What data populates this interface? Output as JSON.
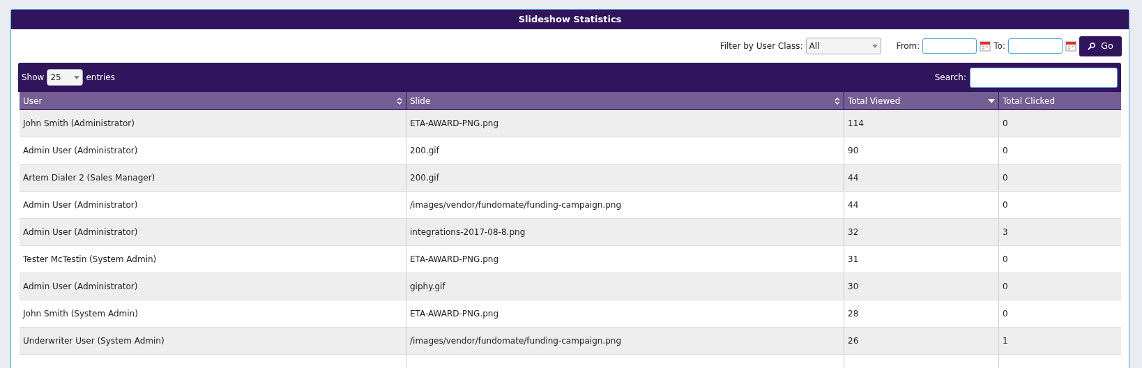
{
  "title": "Slideshow Statistics",
  "filter": {
    "label": "Filter by User Class:",
    "value": "All",
    "from_label": "From:",
    "to_label": "To:",
    "go": "Go"
  },
  "table_toolbar": {
    "show": "Show",
    "length": "25",
    "entries": "entries",
    "search_label": "Search:"
  },
  "columns": [
    {
      "label": "User",
      "sortable": true,
      "sorted": false
    },
    {
      "label": "Slide",
      "sortable": true,
      "sorted": false
    },
    {
      "label": "Total Viewed",
      "sortable": true,
      "sorted": true
    },
    {
      "label": "Total Clicked",
      "sortable": false,
      "sorted": false
    }
  ],
  "rows": [
    [
      "John Smith (Administrator)",
      "ETA-AWARD-PNG.png",
      "114",
      "0"
    ],
    [
      "Admin User (Administrator)",
      "200.gif",
      "90",
      "0"
    ],
    [
      "Artem Dialer 2 (Sales Manager)",
      "200.gif",
      "44",
      "0"
    ],
    [
      "Admin User (Administrator)",
      "/images/vendor/fundomate/funding-campaign.png",
      "44",
      "0"
    ],
    [
      "Admin User (Administrator)",
      "integrations-2017-08-8.png",
      "32",
      "3"
    ],
    [
      "Tester McTestin (System Admin)",
      "ETA-AWARD-PNG.png",
      "31",
      "0"
    ],
    [
      "Admin User (Administrator)",
      "giphy.gif",
      "30",
      "0"
    ],
    [
      "John Smith (System Admin)",
      "ETA-AWARD-PNG.png",
      "28",
      "0"
    ],
    [
      "Underwriter User (System Admin)",
      "/images/vendor/fundomate/funding-campaign.png",
      "26",
      "1"
    ]
  ]
}
